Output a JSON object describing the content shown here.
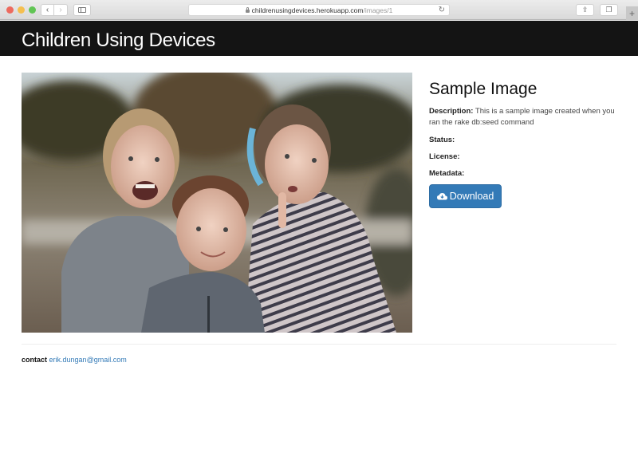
{
  "browser": {
    "url_host": "childrenusingdevices.herokuapp.com",
    "url_path": "/images/1",
    "icons": {
      "back": "chevron-left-icon",
      "forward": "chevron-right-icon",
      "sidebar": "sidebar-icon",
      "lock": "lock-icon",
      "reload": "reload-icon",
      "share": "share-icon",
      "tabs": "tabs-icon",
      "new_tab": "plus-icon"
    },
    "glyphs": {
      "back": "‹",
      "forward": "›",
      "reload": "↻",
      "share": "⇪",
      "tabs": "❐",
      "new_tab": "+"
    }
  },
  "navbar": {
    "brand": "Children Using Devices"
  },
  "image": {
    "alt": "Three children smiling outdoors",
    "title": "Sample Image",
    "description_label": "Description:",
    "description": "This is a sample image created when you ran the rake db:seed command",
    "status_label": "Status:",
    "status": "",
    "license_label": "License:",
    "license": "",
    "metadata_label": "Metadata:",
    "metadata": "",
    "download_label": "Download",
    "download_icon": "cloud-download-icon"
  },
  "footer": {
    "contact_label": "contact",
    "email": "erik.dungan@gmail.com"
  },
  "colors": {
    "navbar_bg": "#141414",
    "primary": "#337ab7",
    "link": "#337ab7"
  }
}
